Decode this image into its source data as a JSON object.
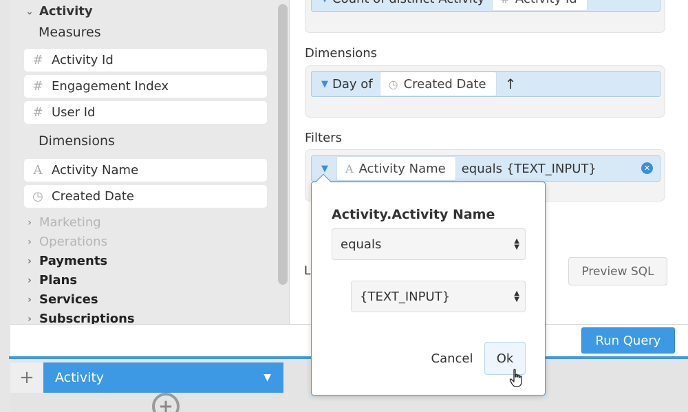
{
  "schema": {
    "active_model": "Activity",
    "measures_label": "Measures",
    "measures": [
      {
        "icon": "#",
        "label": "Activity Id"
      },
      {
        "icon": "#",
        "label": "Engagement Index"
      },
      {
        "icon": "#",
        "label": "User Id"
      }
    ],
    "dimensions_label": "Dimensions",
    "dimensions": [
      {
        "icon": "A",
        "label": "Activity Name"
      },
      {
        "icon": "◷",
        "label": "Created Date"
      }
    ],
    "other_models": [
      "Marketing",
      "Operations",
      "Payments",
      "Plans",
      "Services",
      "Subscriptions"
    ]
  },
  "query": {
    "measure_pill": {
      "aggregation": "Count of distinct Activity",
      "field_icon": "#",
      "field": "Activity Id"
    },
    "dimensions_heading": "Dimensions",
    "dimension_pill": {
      "granularity": "Day of",
      "field_icon": "◷",
      "field": "Created Date",
      "sort_arrow": "↑"
    },
    "filters_heading": "Filters",
    "filter_pill": {
      "field_icon": "A",
      "field": "Activity Name",
      "condition": "equals {TEXT_INPUT}"
    },
    "limit_label": "L",
    "preview_sql_label": "Preview SQL",
    "run_query_label": "Run Query"
  },
  "tabs": {
    "add_label": "+",
    "active_tab": "Activity",
    "dropdown_glyph": "▼"
  },
  "popover": {
    "title": "Activity.Activity Name",
    "operator": "equals",
    "value": "{TEXT_INPUT}",
    "cancel_label": "Cancel",
    "ok_label": "Ok"
  },
  "colors": {
    "accent": "#3d99e4",
    "pill_bg": "#d7e8f7",
    "clear_icon": "#3b8fd8"
  }
}
